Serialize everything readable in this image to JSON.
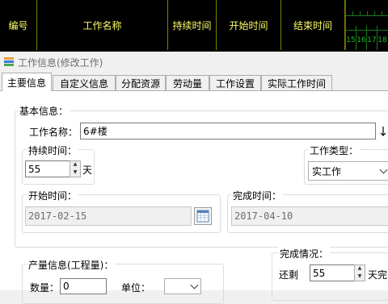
{
  "grid": {
    "columns": [
      "编号",
      "工作名称",
      "持续时间",
      "开始时间",
      "结束时间"
    ],
    "timeline_days": [
      "15",
      "16",
      "17",
      "18"
    ]
  },
  "dialog": {
    "title": "工作信息(修改工作)"
  },
  "tabs": [
    "主要信息",
    "自定义信息",
    "分配资源",
    "劳动量",
    "工作设置",
    "实际工作时间"
  ],
  "basic": {
    "group_label": "基本信息：",
    "name_label": "工作名称：",
    "name_value": "6#楼",
    "duration_label": "持续时间：",
    "duration_value": "55",
    "duration_unit": "天",
    "type_label": "工作类型：",
    "type_value": "实工作",
    "start_label": "开始时间：",
    "start_value": "2017-02-15",
    "end_label": "完成时间：",
    "end_value": "2017-04-10"
  },
  "output": {
    "group_label": "产量信息(工程量)：",
    "qty_label": "数量：",
    "qty_value": "0",
    "unit_label": "单位：",
    "unit_value": ""
  },
  "completion": {
    "group_label": "完成情况：",
    "remain_label": "还剩",
    "remain_value": "55",
    "remain_unit": "天完"
  },
  "colors": {
    "grid_bg": "#000000",
    "grid_text": "#ffff66",
    "timeline": "#1fbf1f"
  }
}
